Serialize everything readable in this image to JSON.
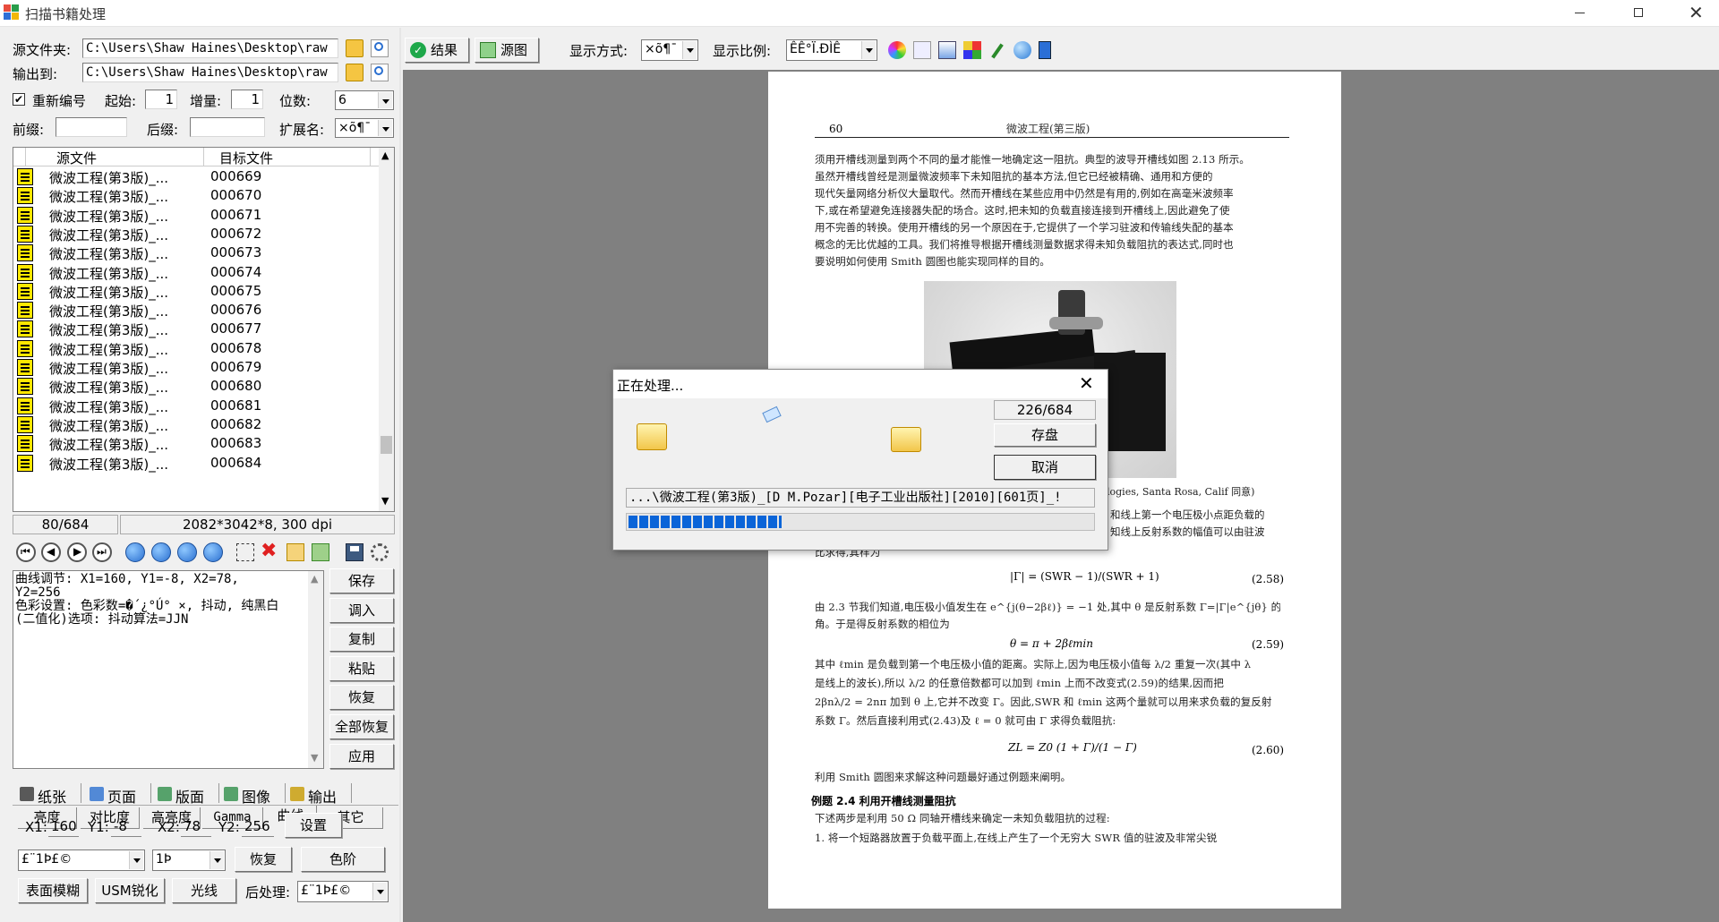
{
  "window": {
    "title": "扫描书籍处理"
  },
  "source": {
    "label": "源文件夹:",
    "path": "C:\\Users\\Shaw Haines\\Desktop\\raw"
  },
  "output": {
    "label": "输出到:",
    "path": "C:\\Users\\Shaw Haines\\Desktop\\raw"
  },
  "renumber": {
    "label": "重新编号",
    "checked": true,
    "start_label": "起始:",
    "start": "1",
    "step_label": "增量:",
    "step": "1",
    "digits_label": "位数:",
    "digits": "6"
  },
  "affix": {
    "prefix_label": "前缀:",
    "prefix": "",
    "suffix_label": "后缀:",
    "suffix": "",
    "ext_label": "扩展名:",
    "ext": "×õ¶¯"
  },
  "filelist": {
    "headers": [
      "源文件",
      "目标文件"
    ],
    "rows": [
      {
        "src": "微波工程(第3版)_...",
        "dst": "000669"
      },
      {
        "src": "微波工程(第3版)_...",
        "dst": "000670"
      },
      {
        "src": "微波工程(第3版)_...",
        "dst": "000671"
      },
      {
        "src": "微波工程(第3版)_...",
        "dst": "000672"
      },
      {
        "src": "微波工程(第3版)_...",
        "dst": "000673"
      },
      {
        "src": "微波工程(第3版)_...",
        "dst": "000674"
      },
      {
        "src": "微波工程(第3版)_...",
        "dst": "000675"
      },
      {
        "src": "微波工程(第3版)_...",
        "dst": "000676"
      },
      {
        "src": "微波工程(第3版)_...",
        "dst": "000677"
      },
      {
        "src": "微波工程(第3版)_...",
        "dst": "000678"
      },
      {
        "src": "微波工程(第3版)_...",
        "dst": "000679"
      },
      {
        "src": "微波工程(第3版)_...",
        "dst": "000680"
      },
      {
        "src": "微波工程(第3版)_...",
        "dst": "000681"
      },
      {
        "src": "微波工程(第3版)_...",
        "dst": "000682"
      },
      {
        "src": "微波工程(第3版)_...",
        "dst": "000683"
      },
      {
        "src": "微波工程(第3版)_...",
        "dst": "000684"
      }
    ],
    "count": "80/684",
    "image_info": "2082*3042*8, 300 dpi"
  },
  "log": {
    "text": "曲线调节: X1=160, Y1=-8, X2=78,\nY2=256\n色彩设置: 色彩数=�´¿°Ú° ×, 抖动, 纯黑白\n(二值化)选项: 抖动算法=JJN"
  },
  "side_buttons": [
    "保存",
    "调入",
    "复制",
    "粘贴",
    "恢复",
    "全部恢复",
    "应用"
  ],
  "tabs": [
    "纸张",
    "页面",
    "版面",
    "图像",
    "输出"
  ],
  "subtabs": [
    "亮度",
    "对比度",
    "高亮度",
    "Gamma",
    "曲线",
    "其它"
  ],
  "curve": {
    "x1_label": "X1:",
    "x1": "160",
    "y1_label": "Y1:",
    "y1": "-8",
    "x2_label": "X2:",
    "x2": "78",
    "y2_label": "Y2:",
    "y2": "256",
    "set_label": "设置"
  },
  "bottom": {
    "combo1": "£¨1Þ£©",
    "combo2": "1Þ",
    "restore": "恢复",
    "levels": "色阶",
    "blur": "表面模糊",
    "usm": "USM锐化",
    "light": "光线",
    "post_label": "后处理:",
    "post": "£¨1Þ£©"
  },
  "toolbar": {
    "result": "结果",
    "source": "源图",
    "display_label": "显示方式:",
    "display": "×õ¶¯",
    "scale_label": "显示比例:",
    "scale": "ÊÊ°Ï.ÐÌÊ"
  },
  "page": {
    "number": "60",
    "header": "微波工程(第三版)",
    "lines": [
      "须用开槽线测量到两个不同的量才能惟一地确定这一阻抗。典型的波导开槽线如图 2.13 所示。",
      "    虽然开槽线曾经是测量微波频率下未知阻抗的基本方法,但它已经被精确、通用和方便的",
      "现代矢量网络分析仪大量取代。然而开槽线在某些应用中仍然是有用的,例如在高毫米波频率",
      "下,或在希望避免连接器失配的场合。这时,把未知的负载直接连接到开槽线上,因此避免了使",
      "用不完善的转换。使用开槽线的另一个原因在于,它提供了一个学习驻波和传输线失配的基本",
      "概念的无比优越的工具。我们将推导根据开槽线测量数据求得未知负载阻抗的表达式,同时也",
      "要说明如何使用 Smith 圆图也能实现同样的目的。"
    ],
    "caption": "logies, Santa Rosa, Calif 同意)",
    "right_lines": [
      "和线上第一个电压极小点距负载的",
      "知线上反射系数的幅值可以由驻波"
    ],
    "cut_line": "比求得,其样为",
    "eq258": "|Γ| = (SWR − 1)/(SWR + 1)",
    "eq258_no": "(2.58)",
    "lines2": [
      "由 2.3 节我们知道,电压极小值发生在 e^{j(θ−2βℓ)} = −1 处,其中 θ 是反射系数 Γ=|Γ|e^{jθ} 的相位",
      "角。于是得反射系数的相位为"
    ],
    "eq259": "θ = π + 2βℓmin",
    "eq259_no": "(2.59)",
    "lines3": [
      "其中 ℓmin 是负载到第一个电压极小值的距离。实际上,因为电压极小值每 λ/2 重复一次(其中 λ",
      "是线上的波长),所以 λ/2 的任意倍数都可以加到 ℓmin 上而不改变式(2.59)的结果,因而把",
      "2βnλ/2 = 2nπ 加到 θ 上,它并不改变 Γ。因此,SWR 和 ℓmin 这两个量就可以用来求负载的复反射",
      "系数 Γ。然后直接利用式(2.43)及 ℓ = 0 就可由 Γ 求得负载阻抗:"
    ],
    "eq260": "ZL = Z0 (1 + Γ)/(1 − Γ)",
    "eq260_no": "(2.60)",
    "line4": "利用 Smith 圆图来求解这种问题最好通过例题来阐明。",
    "example_title": "例题 2.4   利用开槽线测量阻抗",
    "example_lines": [
      "    下述两步是利用 50 Ω 同轴开槽线来确定一未知负载阻抗的过程:",
      "    1. 将一个短路器放置于负载平面上,在线上产生了一个无穷大 SWR 值的驻波及非常尖锐"
    ]
  },
  "dialog": {
    "title": "正在处理...",
    "progress_text": "226/684",
    "progress_fraction": 0.33,
    "save": "存盘",
    "cancel": "取消",
    "path": "...\\微波工程(第3版)_[D M.Pozar][电子工业出版社][2010][601页]_!"
  },
  "colors": {
    "accent": "#0078d7",
    "progress": "#0a64d8",
    "workspace": "#808080"
  }
}
